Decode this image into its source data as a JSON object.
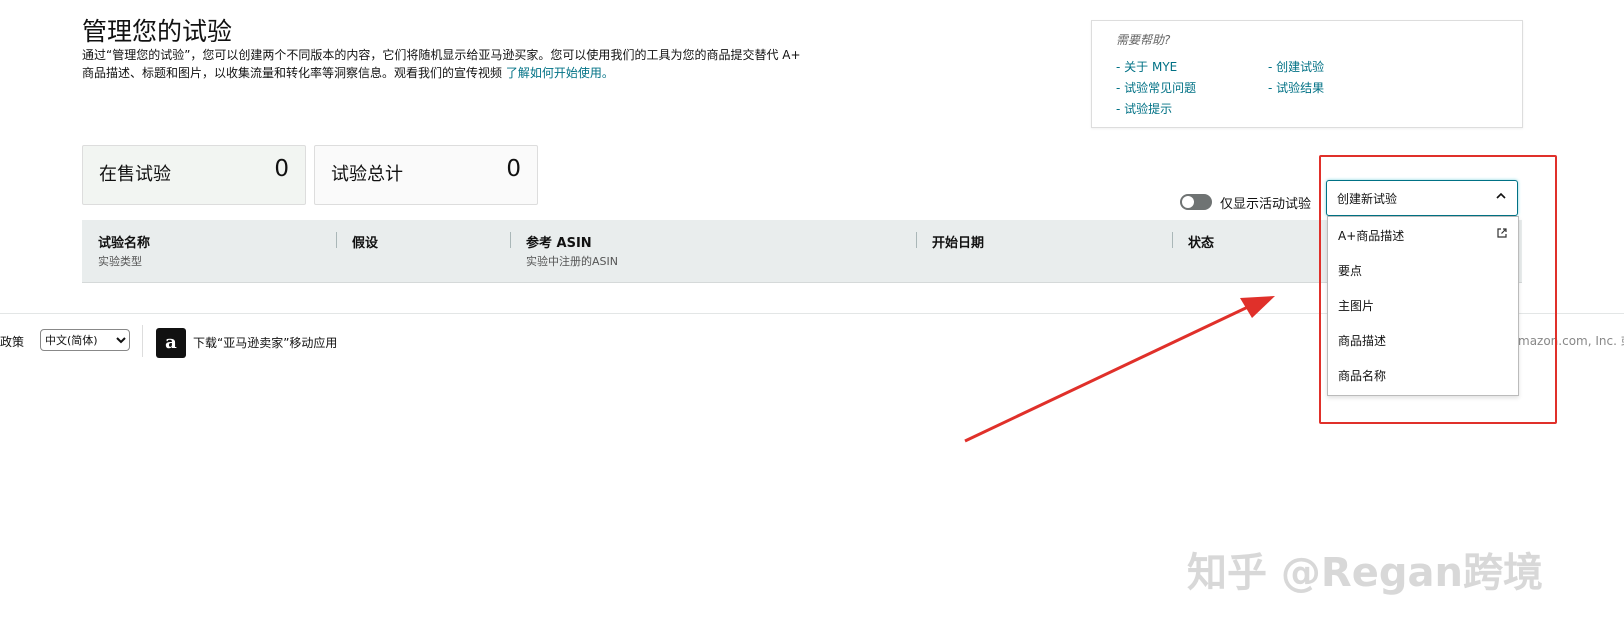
{
  "header": {
    "title": "管理您的试验",
    "description": "通过“管理您的试验”，您可以创建两个不同版本的内容，它们将随机显示给亚马逊买家。您可以使用我们的工具为您的商品提交替代 A+ 商品描述、标题和图片，以收集流量和转化率等洞察信息。观看我们的宣传视频",
    "learn_link": "了解如何开始使用。"
  },
  "help": {
    "heading": "需要帮助?",
    "links": [
      "- 关于 MYE",
      "- 创建试验",
      "- 试验常见问题",
      "- 试验结果",
      "- 试验提示"
    ]
  },
  "stats": [
    {
      "label": "在售试验",
      "value": "0"
    },
    {
      "label": "试验总计",
      "value": "0"
    }
  ],
  "toggle": {
    "label": "仅显示活动试验"
  },
  "table": {
    "columns": [
      {
        "label": "试验名称",
        "sub": "实验类型"
      },
      {
        "label": "假设",
        "sub": ""
      },
      {
        "label": "参考 ASIN",
        "sub": "实验中注册的ASIN"
      },
      {
        "label": "开始日期",
        "sub": ""
      },
      {
        "label": "状态",
        "sub": ""
      }
    ]
  },
  "footer": {
    "left_text": "政策",
    "language": "中文(简体)",
    "app_label": "下载“亚马逊卖家”移动应用",
    "copyright": "mazon.com, Inc. 或"
  },
  "create": {
    "selected": "创建新试验",
    "options": [
      "A+商品描述",
      "要点",
      "主图片",
      "商品描述",
      "商品名称"
    ]
  },
  "watermark": "知乎 @Regan跨境",
  "colors": {
    "accent": "#007185",
    "annotation": "#e0302a"
  }
}
